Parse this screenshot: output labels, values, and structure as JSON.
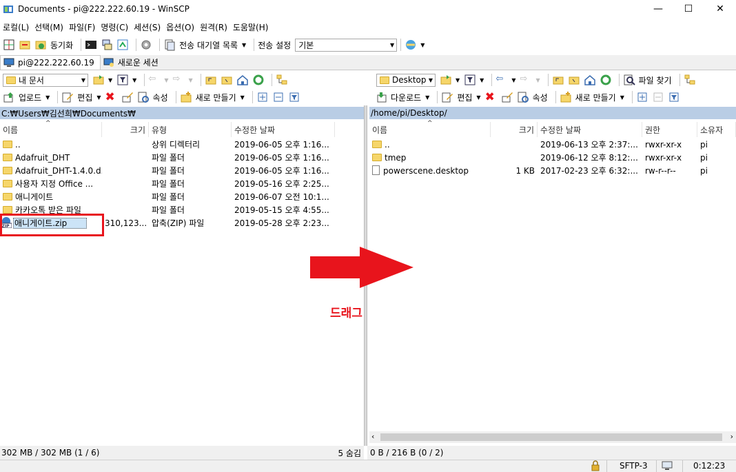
{
  "window": {
    "title": "Documents - pi@222.222.60.19 - WinSCP",
    "minimize": "—",
    "maximize": "☐",
    "close": "✕"
  },
  "menu": [
    "로컬(L)",
    "선택(M)",
    "파일(F)",
    "명령(C)",
    "세션(S)",
    "옵션(O)",
    "원격(R)",
    "도움말(H)"
  ],
  "toolbar1": {
    "sync_label": "동기화",
    "queue_label": "전송 대기열 목록",
    "transfer_settings_label": "전송 설정",
    "transfer_preset": "기본"
  },
  "tabs": {
    "session": "pi@222.222.60.19",
    "new_session": "새로운 세션"
  },
  "left": {
    "location": "내 문서",
    "upload_label": "업로드",
    "edit_label": "편집",
    "properties_label": "속성",
    "new_label": "새로 만들기",
    "path": "C:₩Users₩김선희₩Documents₩",
    "columns": {
      "name": "이름",
      "size": "크기",
      "type": "유형",
      "modified": "수정한 날짜"
    },
    "rows": [
      {
        "name": "..",
        "size": "",
        "type": "상위 디렉터리",
        "modified": "2019-06-05  오후 1:16..."
      },
      {
        "name": "Adafruit_DHT",
        "size": "",
        "type": "파일 폴더",
        "modified": "2019-06-05  오후 1:16..."
      },
      {
        "name": "Adafruit_DHT-1.4.0.d...",
        "size": "",
        "type": "파일 폴더",
        "modified": "2019-06-05  오후 1:16..."
      },
      {
        "name": "사용자 지정 Office ...",
        "size": "",
        "type": "파일 폴더",
        "modified": "2019-05-16  오후 2:25..."
      },
      {
        "name": "애니게이트",
        "size": "",
        "type": "파일 폴더",
        "modified": "2019-06-07  오전 10:1..."
      },
      {
        "name": "카카오톡 받은 파일",
        "size": "",
        "type": "파일 폴더",
        "modified": "2019-05-15  오후 4:55..."
      },
      {
        "name": "애니게이트.zip",
        "size": "310,123...",
        "type": "압축(ZIP) 파일",
        "modified": "2019-05-28  오후 2:23..."
      }
    ],
    "status_size": "302 MB / 302 MB (1 / 6)",
    "status_hidden": "5 숨김"
  },
  "right": {
    "location": "Desktop",
    "download_label": "다운로드",
    "edit_label": "편집",
    "properties_label": "속성",
    "new_label": "새로 만들기",
    "find_label": "파일 찾기",
    "path": "/home/pi/Desktop/",
    "columns": {
      "name": "이름",
      "size": "크기",
      "modified": "수정한 날짜",
      "rights": "권한",
      "owner": "소유자"
    },
    "rows": [
      {
        "name": "..",
        "size": "",
        "modified": "2019-06-13  오후 2:37:...",
        "rights": "rwxr-xr-x",
        "owner": "pi"
      },
      {
        "name": "tmep",
        "size": "",
        "modified": "2019-06-12  오후 8:12:...",
        "rights": "rwxr-xr-x",
        "owner": "pi"
      },
      {
        "name": "powerscene.desktop",
        "size": "1 KB",
        "modified": "2017-02-23  오후 6:32:...",
        "rights": "rw-r--r--",
        "owner": "pi"
      }
    ],
    "status_size": "0 B / 216 B (0 / 2)"
  },
  "bottom": {
    "protocol": "SFTP-3",
    "elapsed": "0:12:23"
  },
  "annotation": {
    "drag_label": "드래그"
  },
  "colors": {
    "path_bar": "#b9cde5",
    "highlight_red": "#e8141c",
    "folder": "#f6d66a"
  }
}
